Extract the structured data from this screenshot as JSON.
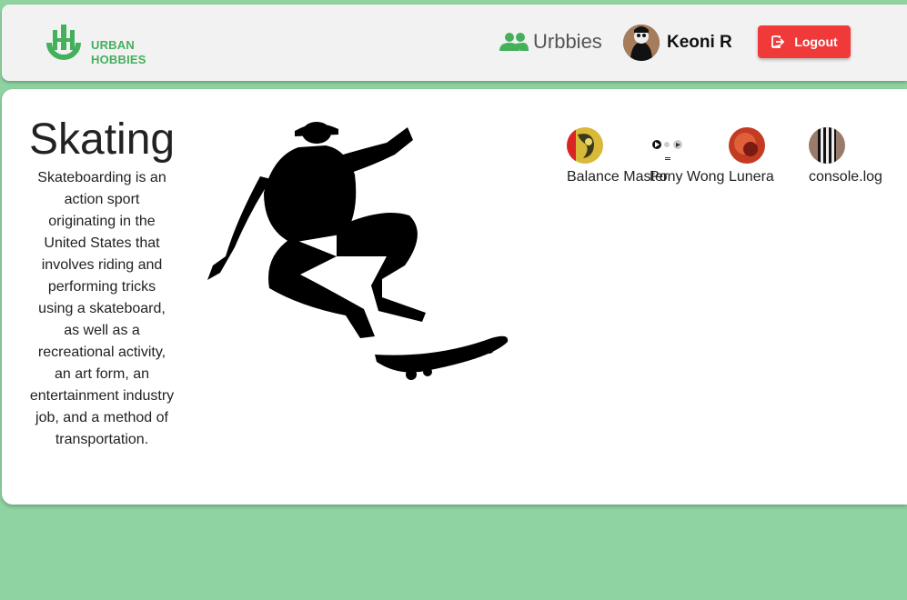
{
  "header": {
    "logo": {
      "line1": "URBAN",
      "line2": "HOBBIES"
    },
    "nav_urbbies_label": "Urbbies",
    "user_name": "Keoni R",
    "logout_label": "Logout"
  },
  "hobby": {
    "title": "Skating",
    "description": "Skateboarding is an action sport originating in the United States that involves riding and performing tricks using a skateboard, as well as a recreational activity, an art form, an entertainment industry job, and a method of transportation."
  },
  "members": [
    {
      "name": "Balance Master"
    },
    {
      "name": "Pony Wong"
    },
    {
      "name": "Lunera"
    },
    {
      "name": "console.log"
    }
  ],
  "colors": {
    "background": "#8ed3a0",
    "brand_green": "#44b05c",
    "logout_red": "#f03a3a"
  }
}
